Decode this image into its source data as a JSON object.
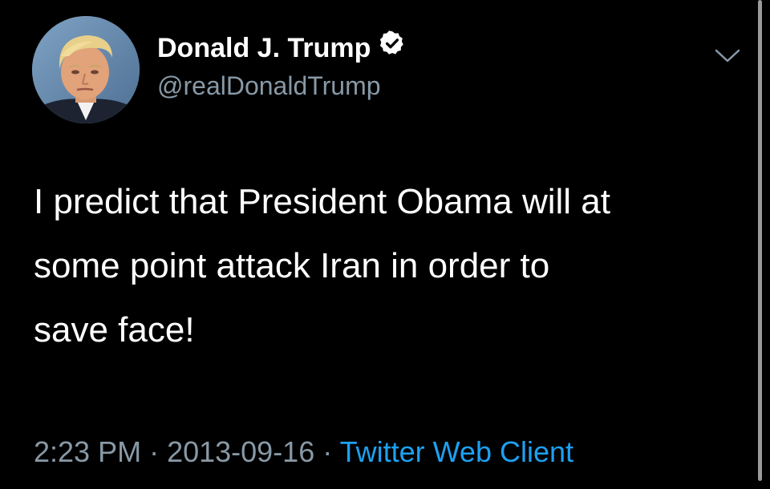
{
  "account": {
    "display_name": "Donald J. Trump",
    "handle": "@realDonaldTrump",
    "verified": true,
    "avatar_icon": "profile-photo",
    "verified_icon": "verified-check-icon",
    "menu_icon": "chevron-down-icon"
  },
  "tweet": {
    "text": "I predict that President Obama will at\nsome point attack Iran in order to\nsave face!",
    "time": "2:23 PM",
    "separator": " · ",
    "date": "2013-09-16",
    "source": "Twitter Web Client"
  },
  "colors": {
    "background": "#000000",
    "text": "#ffffff",
    "secondary_text": "#8899a6",
    "link": "#1da1f2"
  }
}
